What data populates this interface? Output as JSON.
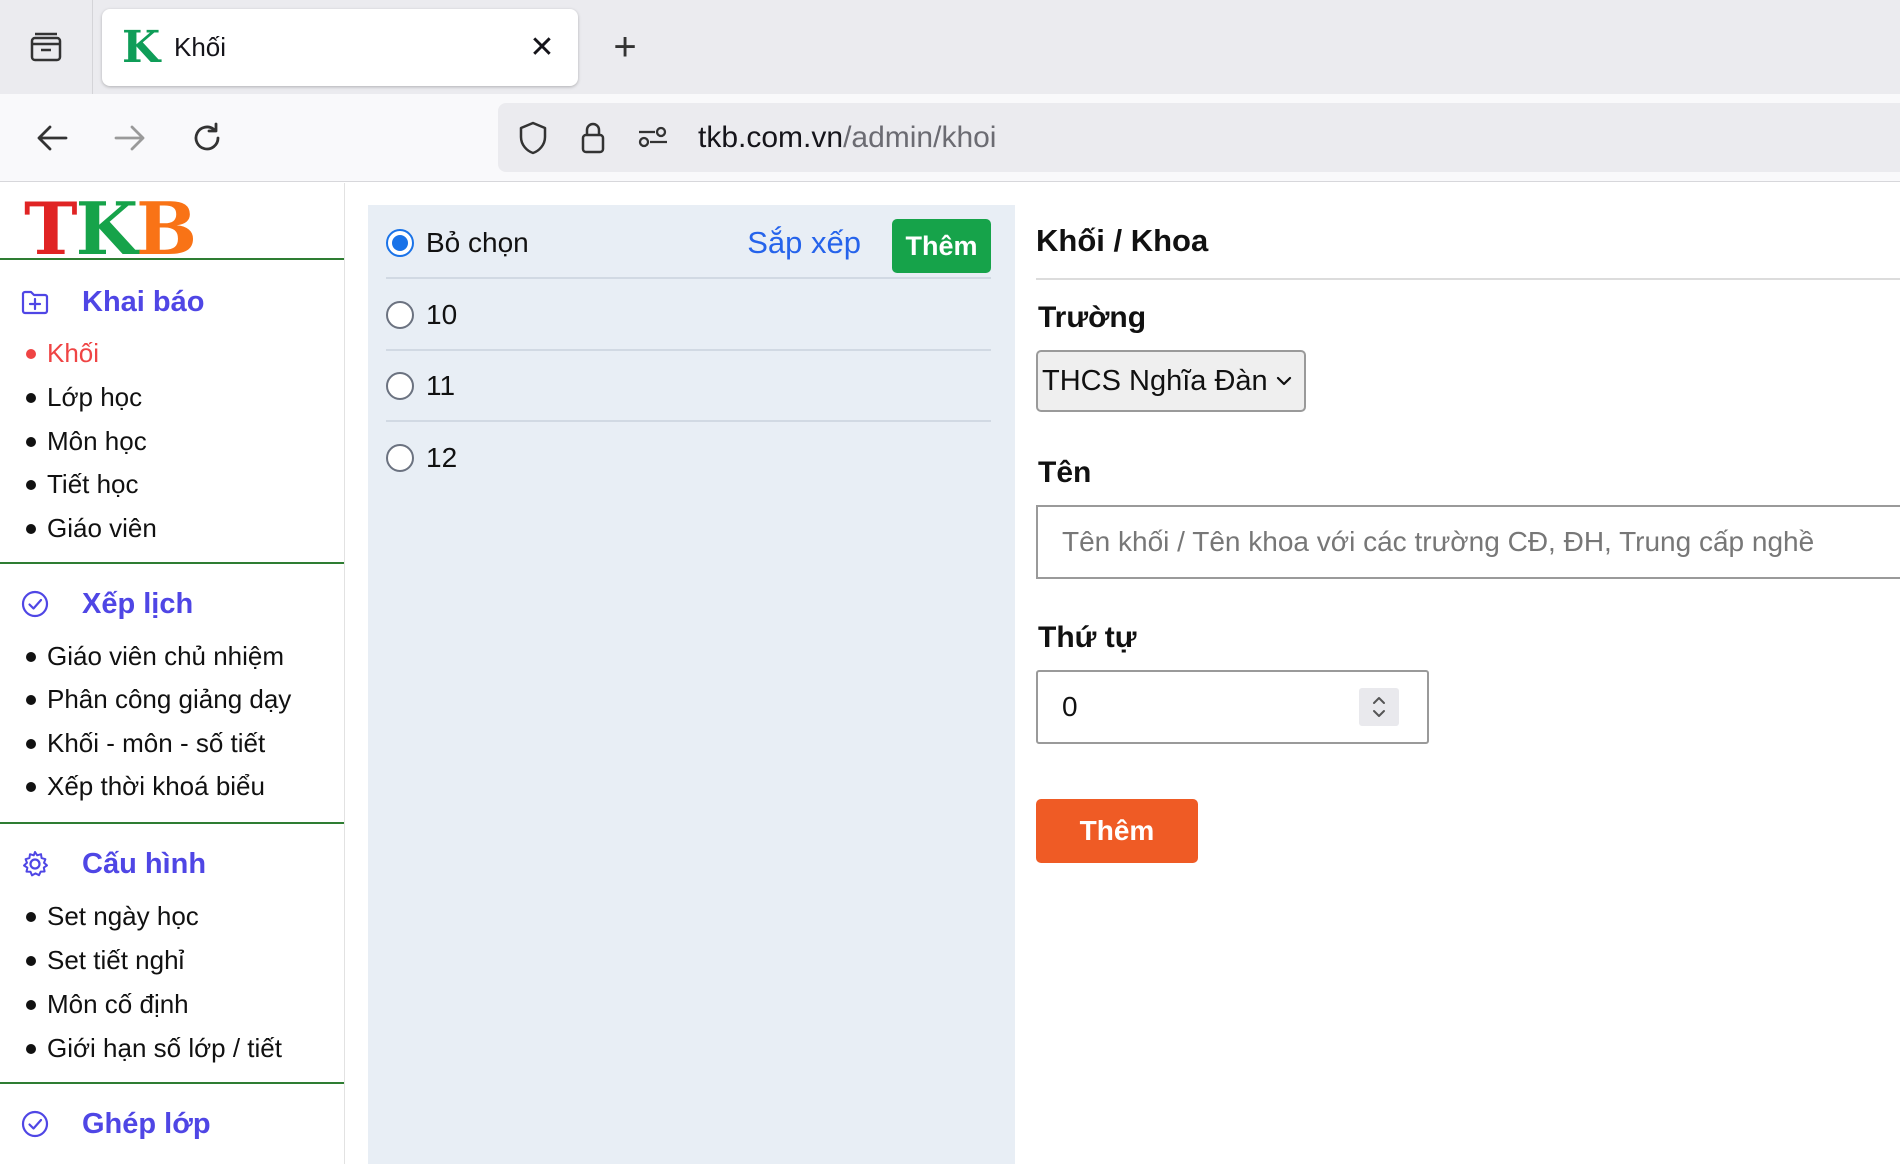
{
  "browser": {
    "tab": {
      "title": "Khối",
      "favicon_letter": "K",
      "close": "✕"
    },
    "new_tab": "+",
    "url": {
      "host": "tkb.com.vn",
      "path": "/admin/khoi"
    }
  },
  "sidebar": {
    "logo": {
      "t": "T",
      "k": "K",
      "b": "B"
    },
    "sections": [
      {
        "label": "Khai báo",
        "icon": "folder-plus-icon",
        "items": [
          "Khối",
          "Lớp học",
          "Môn học",
          "Tiết học",
          "Giáo viên"
        ]
      },
      {
        "label": "Xếp lịch",
        "icon": "check-circle-icon",
        "items": [
          "Giáo viên chủ nhiệm",
          "Phân công giảng dạy",
          "Khối - môn - số tiết",
          "Xếp thời khoá biểu"
        ]
      },
      {
        "label": "Cấu hình",
        "icon": "gear-icon",
        "items": [
          "Set ngày học",
          "Set tiết nghỉ",
          "Môn cố định",
          "Giới hạn số lớp / tiết"
        ]
      },
      {
        "label": "Ghép lớp",
        "icon": "check-circle-icon",
        "items": []
      }
    ],
    "active_item": "Khối"
  },
  "list": {
    "deselect_label": "Bỏ chọn",
    "sort_label": "Sắp xếp",
    "add_label": "Thêm",
    "items": [
      "10",
      "11",
      "12"
    ]
  },
  "form": {
    "title": "Khối / Khoa",
    "school_label": "Trường",
    "school_value": "THCS Nghĩa Đàn",
    "name_label": "Tên",
    "name_placeholder": "Tên khối / Tên khoa với các trường CĐ, ĐH, Trung cấp nghề",
    "order_label": "Thứ tự",
    "order_value": "0",
    "submit_label": "Thêm"
  },
  "colors": {
    "accent_indigo": "#4f46e5",
    "active_red": "#ef4444",
    "add_green": "#16a34a",
    "submit_orange": "#ef5b25",
    "link_blue": "#2563eb"
  }
}
